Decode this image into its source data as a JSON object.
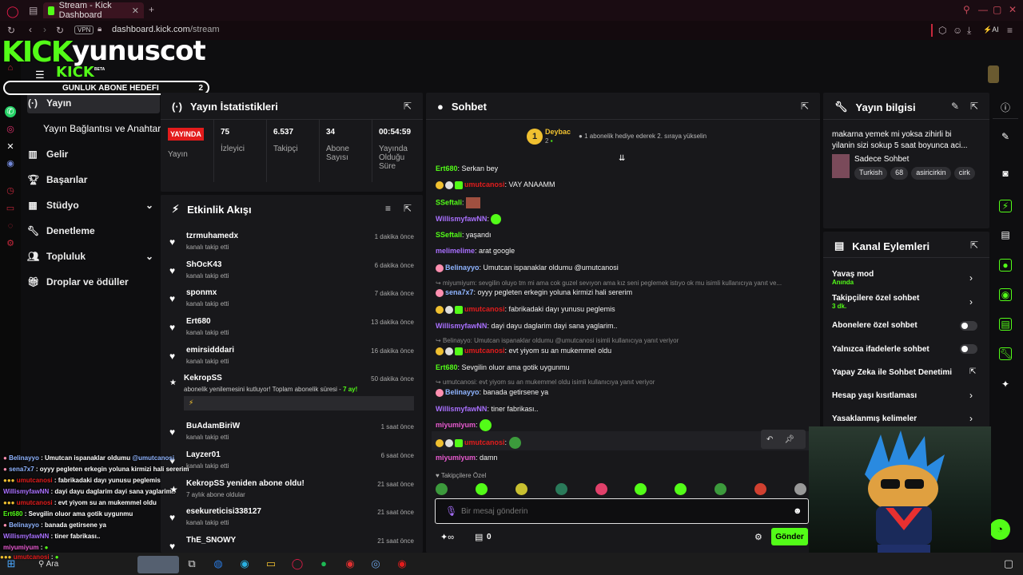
{
  "browser": {
    "tab_title": "Stream - Kick Dashboard",
    "vpn": "VPN",
    "url_domain": "dashboard.kick.com",
    "url_path": "/stream",
    "ai_label": "AI"
  },
  "overlay": {
    "kick_logo": "KICK",
    "channel_name": "yunuscot",
    "kick_small": "KICK",
    "beta": "BETA",
    "goal_label": "GUNLUK ABONE HEDEFI",
    "goal_count": "2"
  },
  "nav": {
    "items": [
      {
        "label": "Yayın",
        "icon": "broadcast-icon"
      },
      {
        "label": "Yayın Bağlantısı ve Anahtarı",
        "icon": ""
      },
      {
        "label": "Gelir",
        "icon": "chart-icon"
      },
      {
        "label": "Başarılar",
        "icon": "trophy-icon"
      },
      {
        "label": "Stüdyo",
        "icon": "studio-icon"
      },
      {
        "label": "Denetleme",
        "icon": "wrench-icon"
      },
      {
        "label": "Topluluk",
        "icon": "people-icon"
      },
      {
        "label": "Droplar ve ödüller",
        "icon": "gift-icon"
      }
    ]
  },
  "stats": {
    "title": "Yayın İstatistikleri",
    "live_badge": "YAYINDA",
    "live_label": "Yayın",
    "viewers": "75",
    "viewers_label": "İzleyici",
    "followers": "6.537",
    "followers_label": "Takipçi",
    "subs": "34",
    "subs_label_1": "Abone",
    "subs_label_2": "Sayısı",
    "uptime": "00:54:59",
    "uptime_label_1": "Yayında",
    "uptime_label_2": "Olduğu",
    "uptime_label_3": "Süre"
  },
  "activity": {
    "title": "Etkinlik Akışı",
    "items": [
      {
        "name": "tzrmuhamedx",
        "sub": "kanalı takip etti",
        "time": "1 dakika önce"
      },
      {
        "name": "ShOcK43",
        "sub": "kanalı takip etti",
        "time": "6 dakika önce"
      },
      {
        "name": "sponmx",
        "sub": "kanalı takip etti",
        "time": "7 dakika önce"
      },
      {
        "name": "Ert680",
        "sub": "kanalı takip etti",
        "time": "13 dakika önce"
      },
      {
        "name": "emirsidddari",
        "sub": "kanalı takip etti",
        "time": "16 dakika önce"
      },
      {
        "name": "KekropSS",
        "sub": "abonelik yenilemesini kutluyor! Toplam abonelik süresi - ",
        "months": "7 ay!",
        "time": "50 dakika önce"
      },
      {
        "name": "BuAdamBiriW",
        "sub": "kanalı takip etti",
        "time": "1 saat önce"
      },
      {
        "name": "Layzer01",
        "sub": "kanalı takip etti",
        "time": "6 saat önce"
      },
      {
        "name": "KekropSS yeniden abone oldu!",
        "sub": "7 aylık abone oldular",
        "time": "21 saat önce"
      },
      {
        "name": "esekureticisi338127",
        "sub": "kanalı takip etti",
        "time": "21 saat önce"
      },
      {
        "name": "ThE_SNOWY",
        "sub": "",
        "time": "21 saat önce"
      }
    ]
  },
  "chat": {
    "title": "Sohbet",
    "pinned_user": "Deybac",
    "pinned_count": "2",
    "pinned_rank": "1",
    "pinned_text": "1 abonelik hediye ederek 2. sıraya yükselin",
    "messages": [
      {
        "user": "Ert680",
        "color": "#53fc18",
        "text": "Serkan bey"
      },
      {
        "user": "umutcanosi",
        "color": "#e31c1c",
        "text": "VAY ANAAMM"
      },
      {
        "user": "SSeftali",
        "color": "#53fc18",
        "text": ""
      },
      {
        "user": "WillismyfawNN",
        "color": "#a970ff",
        "text": ""
      },
      {
        "user": "SSeftali",
        "color": "#53fc18",
        "text": "yaşandı"
      },
      {
        "user": "melimelime",
        "color": "#a970ff",
        "text": "arat google"
      },
      {
        "user": "Belinayyo",
        "color": "#8fb4ff",
        "text": "Umutcan ispanaklar oldumu @umutcanosi"
      },
      {
        "reply": "miyumiyum: sevgilin oluyo tm mi ama cok guzel sevıyon ama kız seni peglemek istıyo ok mu isimli kullanıcıya yanıt ve..."
      },
      {
        "user": "sena7x7",
        "color": "#8fb4ff",
        "text": "oyyy pegleten erkegin yoluna kirmizi hali sererim"
      },
      {
        "user": "umutcanosi",
        "color": "#e31c1c",
        "text": "fabrikadaki dayı yunusu peglemis"
      },
      {
        "user": "WillismyfawNN",
        "color": "#a970ff",
        "text": "dayi dayu daglarim dayi sana yaglarim.."
      },
      {
        "reply": "Belinayyo: Umutcan ispanaklar oldumu @umutcanosi isimli kullanıcıya yanıt veriyor"
      },
      {
        "user": "umutcanosi",
        "color": "#e31c1c",
        "text": "evt yiyom su an mukemmel oldu"
      },
      {
        "user": "Ert680",
        "color": "#53fc18",
        "text": "Sevgilin oluor ama gotik uygunmu"
      },
      {
        "reply": "umutcanosi: evt yiyom su an mukemmel oldu isimli kullanıcıya yanıt veriyor"
      },
      {
        "user": "Belinayyo",
        "color": "#8fb4ff",
        "text": "banada getirsene ya"
      },
      {
        "user": "WillismyfawNN",
        "color": "#a970ff",
        "text": "tiner fabrikası.."
      },
      {
        "user": "miyumiyum",
        "color": "#e85ad0",
        "text": ""
      },
      {
        "user": "umutcanosi",
        "color": "#e31c1c",
        "text": ""
      },
      {
        "user": "miyumiyum",
        "color": "#e85ad0",
        "text": "damn"
      }
    ],
    "followers_only": "Takipçilere Özel",
    "input_placeholder": "Bir mesaj gönderin",
    "points": "0",
    "send_label": "Gönder"
  },
  "info": {
    "title": "Yayın bilgisi",
    "stream_title_1": "makarna yemek mi yoksa zihirli bi",
    "stream_title_2": "yilanin sizi sokup 5 saat boyunca aci...",
    "category": "Sadece Sohbet",
    "tags": [
      "Turkish",
      "68",
      "asiricirkin",
      "cirk"
    ]
  },
  "actions": {
    "title": "Kanal Eylemleri",
    "slow_mode": "Yavaş mod",
    "slow_mode_value": "Anında",
    "followers_chat": "Takipçilere özel sohbet",
    "followers_chat_value": "3 dk.",
    "subs_chat": "Abonelere özel sohbet",
    "emote_chat": "Yalnızca ifadelerle sohbet",
    "ai_mod": "Yapay Zeka ile Sohbet Denetimi",
    "age_restrict": "Hesap yaşı kısıtlaması",
    "banned_words": "Yasaklanmış kelimeler"
  },
  "overlay_chat": [
    {
      "user": "Belinayyo",
      "color": "#8fb4ff",
      "text": " : Umutcan ispanaklar oldumu ",
      "mention": "@umutcanosi"
    },
    {
      "user": "sena7x7",
      "color": "#8fb4ff",
      "text": " : oyyy pegleten erkegin yoluna kirmizi hali sererim"
    },
    {
      "user": "umutcanosi",
      "color": "#e31c1c",
      "text": " : fabrikadaki dayı yunusu peglemis"
    },
    {
      "user": "WillismyfawNN",
      "color": "#a970ff",
      "text": " : dayi dayu daglarim dayi sana yaglarim.."
    },
    {
      "user": "umutcanosi",
      "color": "#e31c1c",
      "text": " : evt yiyom su an mukemmel oldu"
    },
    {
      "user": "Ert680",
      "color": "#53fc18",
      "text": " : Sevgilin oluor ama gotik uygunmu"
    },
    {
      "user": "Belinayyo",
      "color": "#8fb4ff",
      "text": " : banada getirsene ya"
    },
    {
      "user": "WillismyfawNN",
      "color": "#a970ff",
      "text": " : tiner fabrikası.."
    },
    {
      "user": "miyumiyum",
      "color": "#e85ad0",
      "text": " : "
    },
    {
      "user": "umutcanosi",
      "color": "#e31c1c",
      "text": " : "
    }
  ],
  "taskbar": {
    "search": "Ara"
  },
  "colors": {
    "kick_green": "#53fc18",
    "live_red": "#e31c1c",
    "panel": "#18181b",
    "bg": "#0e0e10"
  }
}
